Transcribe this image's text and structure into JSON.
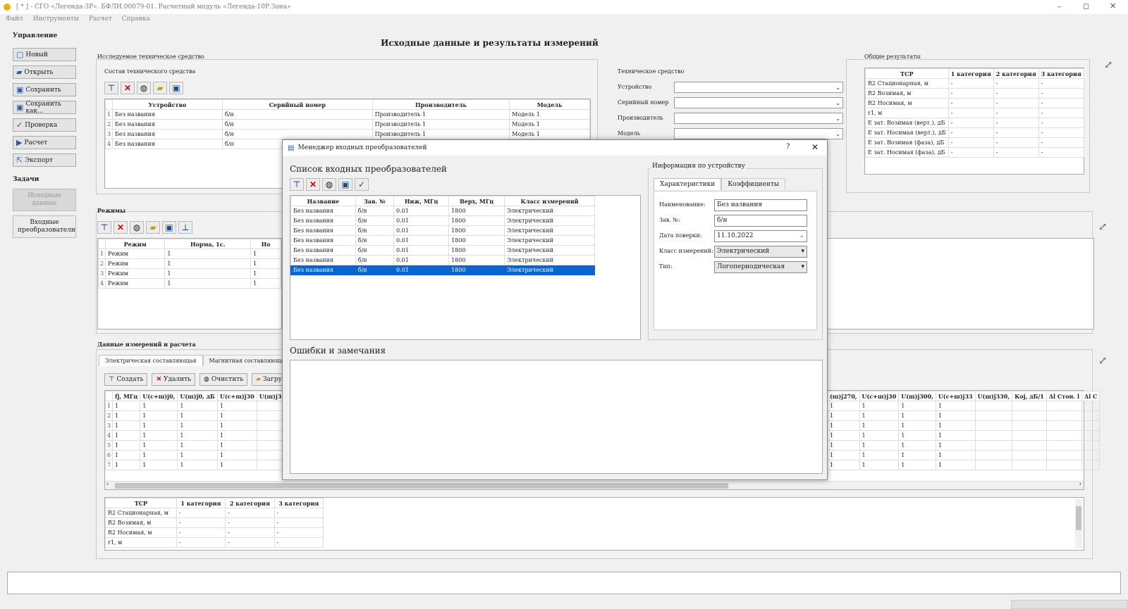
{
  "window": {
    "title": "[ * ] - СГО «Легенда-3Р». БФЛИ.00079-01. Расчетный модуль «Легенда-10Р.Зона»",
    "controls": [
      "–",
      "◻",
      "✕"
    ]
  },
  "menu": [
    "Файл",
    "Инструменты",
    "Расчет",
    "Справка"
  ],
  "sidebar": {
    "section1": "Управление",
    "buttons": [
      {
        "label": "Новый",
        "icon": "new-document-icon",
        "glyph": "▢"
      },
      {
        "label": "Открыть",
        "icon": "open-folder-icon",
        "glyph": "▰"
      },
      {
        "label": "Сохранить",
        "icon": "save-icon",
        "glyph": "▣"
      },
      {
        "label": "Сохранить как...",
        "icon": "save-as-icon",
        "glyph": "▣"
      },
      {
        "label": "Проверка",
        "icon": "check-icon",
        "glyph": "✓"
      },
      {
        "label": "Расчет",
        "icon": "play-icon",
        "glyph": "▶"
      },
      {
        "label": "Экспорт",
        "icon": "export-icon",
        "glyph": "⇱"
      }
    ],
    "section2": "Задачи",
    "task1": "Исходные данные",
    "task2": "Входные преобразователи"
  },
  "page_title": "Исходные данные и результаты измерений",
  "equipment": {
    "title": "Исследуемое техническое средство",
    "subtitle": "Состав технического средства",
    "columns": [
      "Устройство",
      "Серийный номер",
      "Производитель",
      "Модель"
    ],
    "rows": [
      [
        "Без названия",
        "б/н",
        "Производитель 1",
        "Модель 1"
      ],
      [
        "Без названия",
        "б/н",
        "Производитель 1",
        "Модель 1"
      ],
      [
        "Без названия",
        "б/н",
        "Производитель 1",
        "Модель 1"
      ],
      [
        "Без названия",
        "б/н",
        "Производитель 1",
        "Модель 1"
      ]
    ]
  },
  "tech": {
    "title": "Техническое средство",
    "fields": [
      "Устройство",
      "Серийный номер",
      "Производитель",
      "Модель"
    ]
  },
  "general": {
    "title": "Общие результаты",
    "columns": [
      "ТСР",
      "1 категория",
      "2 категория",
      "3 категория"
    ],
    "rows": [
      [
        "R2 Стационарная, м",
        "-",
        "-",
        "-"
      ],
      [
        "R2 Возимая, м",
        "-",
        "-",
        "-"
      ],
      [
        "R2 Носимая, м",
        "-",
        "-",
        "-"
      ],
      [
        "r1, м",
        "-",
        "-",
        "-"
      ],
      [
        "E зат. Возимая (верт.), дБ",
        "-",
        "-",
        "-"
      ],
      [
        "E зат. Носимая (верт.), дБ",
        "-",
        "-",
        "-"
      ],
      [
        "E зат. Возимая (фаза), дБ",
        "-",
        "-",
        "-"
      ],
      [
        "E зат. Носимая (фаза), дБ",
        "-",
        "-",
        "-"
      ]
    ]
  },
  "modes": {
    "title": "Режимы",
    "columns": [
      "Режим",
      "Норма, 1с.",
      "Но"
    ],
    "rows": [
      [
        "Режим",
        "1",
        "1"
      ],
      [
        "Режим",
        "1",
        "1"
      ],
      [
        "Режим",
        "1",
        "1"
      ],
      [
        "Режим",
        "1",
        "1"
      ]
    ]
  },
  "measurements": {
    "title": "Данные измерений и расчета",
    "tabs": [
      "Электрическая составляющая",
      "Магнитная составляющая"
    ],
    "buttons": [
      "Создать",
      "Удалить",
      "Очистить",
      "Загруз"
    ],
    "columns_left": [
      "fj, МГц",
      "U(c+ш)j0, ",
      "U(ш)j0, дБ",
      "U(c+ш)j30",
      "U(ш)j30"
    ],
    "columns_right": [
      "(ш)j270,",
      "U(c+ш)j30",
      "U(ш)j300,",
      "U(c+ш)j33",
      "U(ш)j330,",
      "Кoj, дБ/1",
      "Δl Стон. l",
      "Δl С"
    ],
    "row_count": 7,
    "cell": "1"
  },
  "bottom_table": {
    "columns": [
      "ТСР",
      "1 категория",
      "2 категория",
      "3 категория"
    ],
    "rows": [
      [
        "R2 Стационарная, м",
        "-",
        "-",
        "-"
      ],
      [
        "R2 Возимая, м",
        "-",
        "-",
        "-"
      ],
      [
        "R2 Носимая, м",
        "-",
        "-",
        "-"
      ],
      [
        "r1, м",
        "-",
        "-",
        "-"
      ]
    ]
  },
  "dialog": {
    "title": "Менеджер входных преобразователей",
    "help": "?",
    "close": "✕",
    "list_title": "Список входных преобразователей",
    "columns": [
      "Название",
      "Зав. №",
      "Ниж, МГц",
      "Верх, МГц",
      "Класс измерений"
    ],
    "rows": [
      [
        "Без названия",
        "б/н",
        "0.01",
        "1800",
        "Электрический"
      ],
      [
        "Без названия",
        "б/н",
        "0.01",
        "1800",
        "Электрический"
      ],
      [
        "Без названия",
        "б/н",
        "0.01",
        "1800",
        "Электрический"
      ],
      [
        "Без названия",
        "б/н",
        "0.01",
        "1800",
        "Электрический"
      ],
      [
        "Без названия",
        "б/н",
        "0.01",
        "1800",
        "Электрический"
      ],
      [
        "Без названия",
        "б/н",
        "0.01",
        "1800",
        "Электрический"
      ],
      [
        "Без названия",
        "б/н",
        "0.01",
        "1800",
        "Электрический"
      ]
    ],
    "selected_row": 6,
    "info_title": "Информация по устройству",
    "tabs": [
      "Характеристики",
      "Коэффициенты"
    ],
    "fields": {
      "name_label": "Наименование:",
      "name_value": "Без названия",
      "serial_label": "Зав. №:",
      "serial_value": "б/н",
      "date_label": "Дата поверки:",
      "date_value": "11.10.2022",
      "class_label": "Класс измерений:",
      "class_value": "Электрический",
      "type_label": "Тип:",
      "type_value": "Логопериодическая"
    },
    "errors_title": "Ошибки и замечания"
  }
}
